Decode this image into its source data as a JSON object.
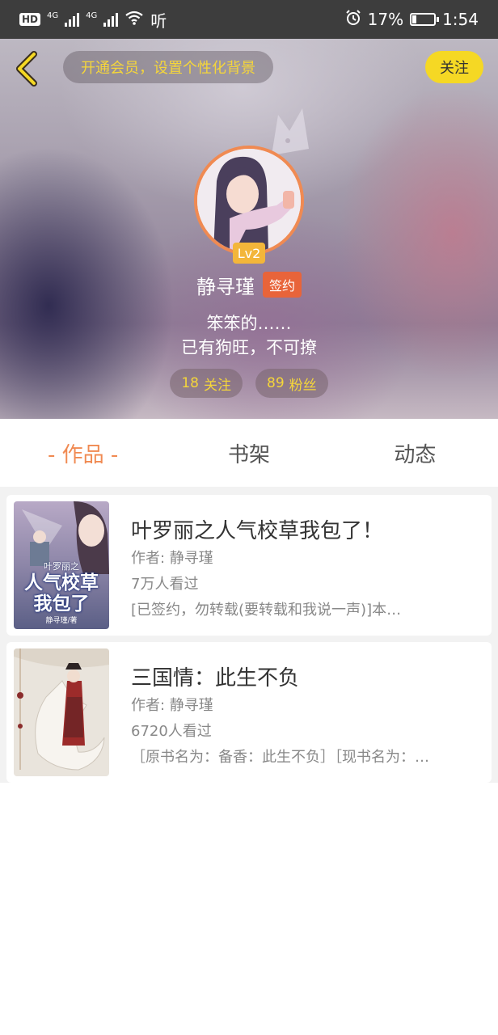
{
  "status_bar": {
    "hd_label": "HD",
    "network1": "4G",
    "network2": "4G",
    "app_label": "听",
    "battery": "17%",
    "time": "1:54"
  },
  "header": {
    "vip_banner": "开通会员，设置个性化背景",
    "follow_label": "关注"
  },
  "profile": {
    "level": "Lv2",
    "username": "静寻瑾",
    "signed_badge": "签约",
    "bio_line1": "笨笨的……",
    "bio_line2": "已有狗旺，不可撩",
    "following_count": "18",
    "following_label": "关注",
    "fans_count": "89",
    "fans_label": "粉丝"
  },
  "tabs": [
    {
      "label": "作品",
      "active": true
    },
    {
      "label": "书架",
      "active": false
    },
    {
      "label": "动态",
      "active": false
    }
  ],
  "books": [
    {
      "title": "叶罗丽之人气校草我包了！",
      "author": "作者: 静寻瑾",
      "views": "7万人看过",
      "desc": "[已签约，勿转载(要转载和我说一声)]本…",
      "cover_text_top": "叶罗丽之",
      "cover_text_main1": "人气校草",
      "cover_text_main2": "我包了",
      "cover_text_author": "静寻瑾/著"
    },
    {
      "title": "三国情：此生不负",
      "author": "作者: 静寻瑾",
      "views": "6720人看过",
      "desc": "［原书名为：备香：此生不负］［现书名为：…"
    }
  ],
  "colors": {
    "accent": "#f08a52",
    "gold": "#f5d63a",
    "follow_bg": "#f5d824",
    "sign_badge": "#e8643a"
  }
}
